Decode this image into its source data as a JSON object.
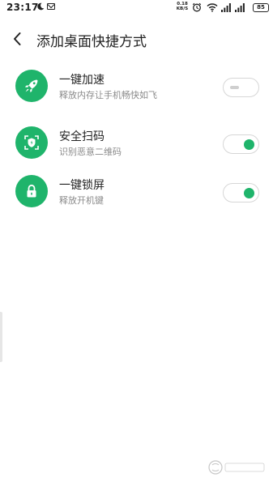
{
  "status_bar": {
    "time": "23:17",
    "net_speed_value": "0.18",
    "net_speed_unit": "KB/S",
    "battery": "85",
    "icons": [
      "moon-icon",
      "mail-icon",
      "alarm-icon",
      "wifi-icon",
      "signal-icon",
      "signal-icon"
    ]
  },
  "header": {
    "title": "添加桌面快捷方式",
    "back_icon": "chevron-left-icon"
  },
  "items": [
    {
      "title": "一键加速",
      "subtitle": "释放内存让手机畅快如飞",
      "icon": "rocket-icon",
      "enabled": false
    },
    {
      "title": "安全扫码",
      "subtitle": "识别恶意二维码",
      "icon": "shield-scan-icon",
      "enabled": true
    },
    {
      "title": "一键锁屏",
      "subtitle": "释放开机键",
      "icon": "lock-icon",
      "enabled": true
    }
  ],
  "colors": {
    "accent": "#1fb46b",
    "toggle_off": "#cfcfcf",
    "subtitle": "#8a8a8a"
  }
}
